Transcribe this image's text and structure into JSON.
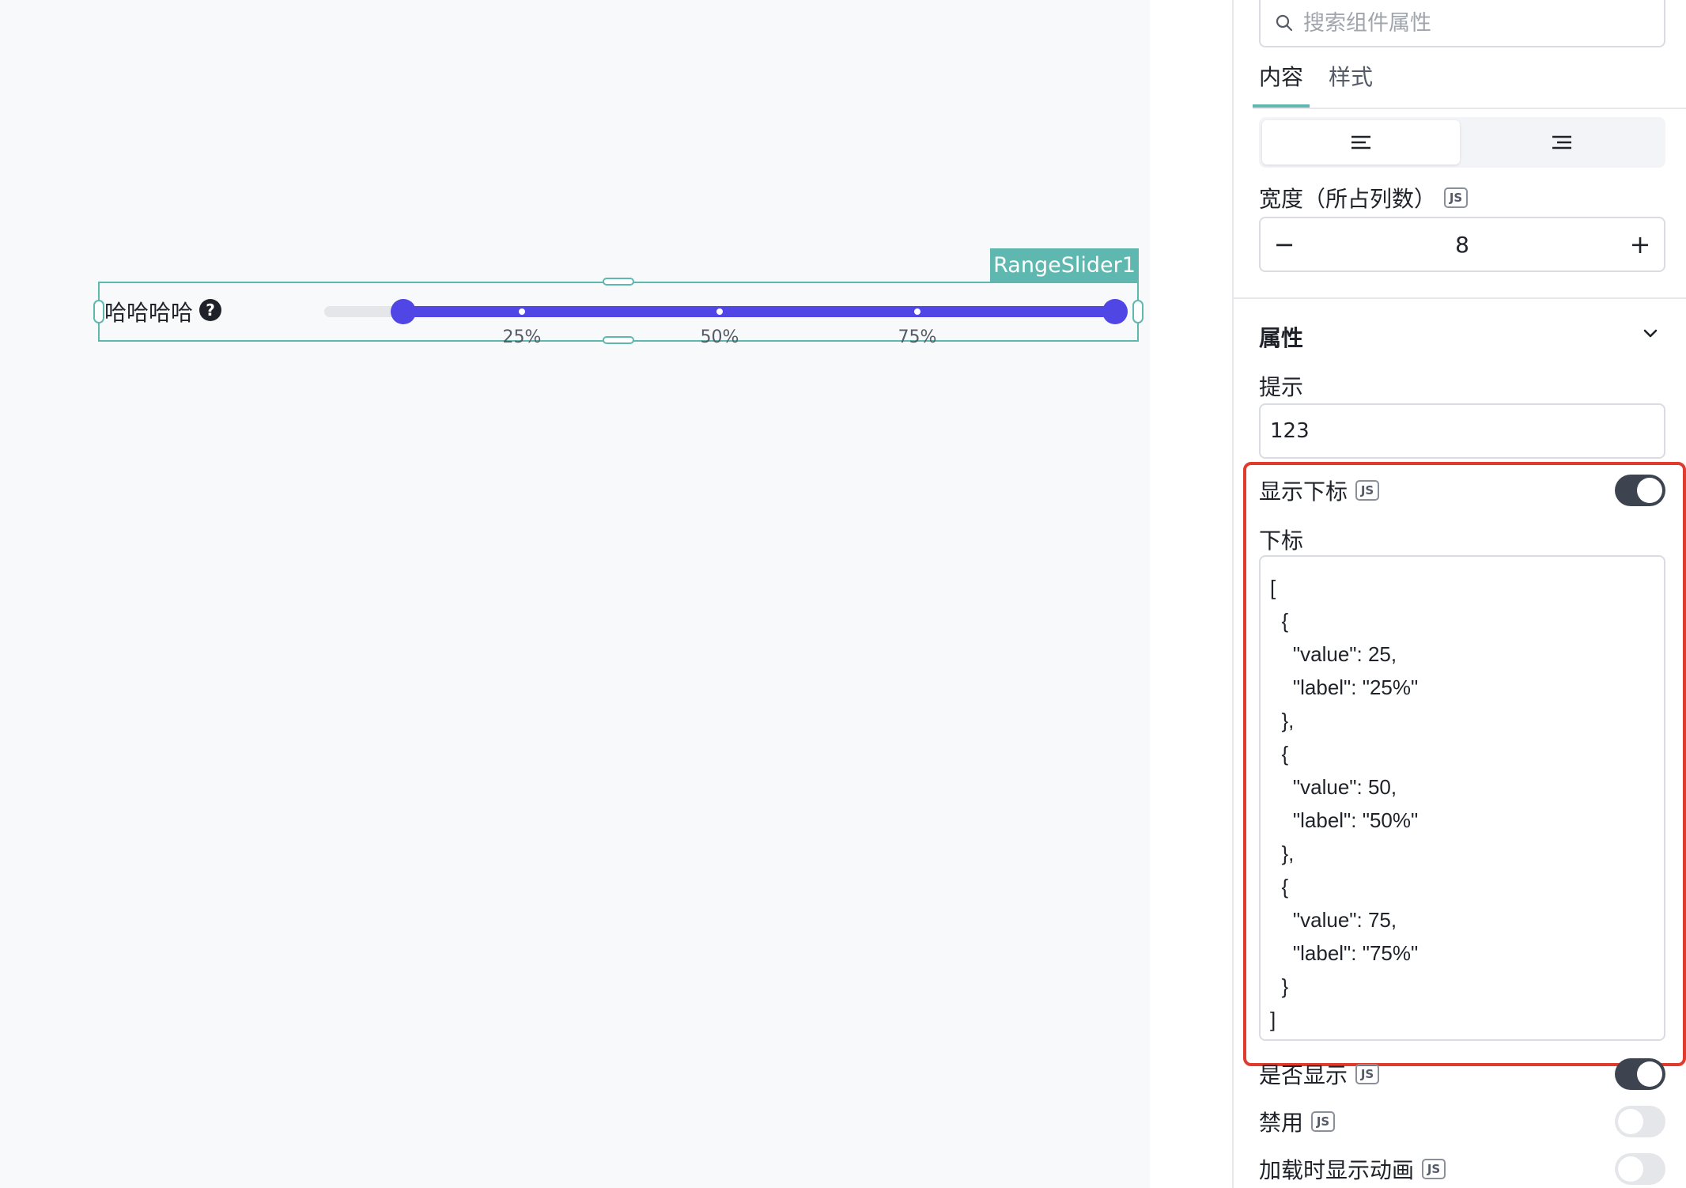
{
  "canvas": {
    "component_tag": "RangeSlider1",
    "field_label": "哈哈哈哈",
    "help_icon_glyph": "?",
    "slider": {
      "min": 0,
      "max": 100,
      "range": [
        10,
        100
      ],
      "marks": [
        {
          "value": 25,
          "label": "25%"
        },
        {
          "value": 50,
          "label": "50%"
        },
        {
          "value": 75,
          "label": "75%"
        }
      ],
      "track_color": "#e4e6ea",
      "active_color": "#5046e5"
    }
  },
  "panel": {
    "search_placeholder": "搜索组件属性",
    "tabs": [
      {
        "label": "内容",
        "active": true
      },
      {
        "label": "样式",
        "active": false
      }
    ],
    "width_label": "宽度（所占列数）",
    "js_badge": "JS",
    "width_value": "8",
    "minus_glyph": "−",
    "plus_glyph": "+",
    "section_title": "属性",
    "tip_label": "提示",
    "tip_value": "123",
    "show_marks_label": "显示下标",
    "show_marks_on": true,
    "marks_label": "下标",
    "marks_code": "[\n  {\n    \"value\": 25,\n    \"label\": \"25%\"\n  },\n  {\n    \"value\": 50,\n    \"label\": \"50%\"\n  },\n  {\n    \"value\": 75,\n    \"label\": \"75%\"\n  }\n]",
    "visible_label": "是否显示",
    "visible_on": true,
    "disabled_label": "禁用",
    "disabled_on": false,
    "animation_label": "加载时显示动画",
    "animation_on": false,
    "highlight_color": "#e03c2d",
    "accent_color": "#5fb8b0"
  }
}
